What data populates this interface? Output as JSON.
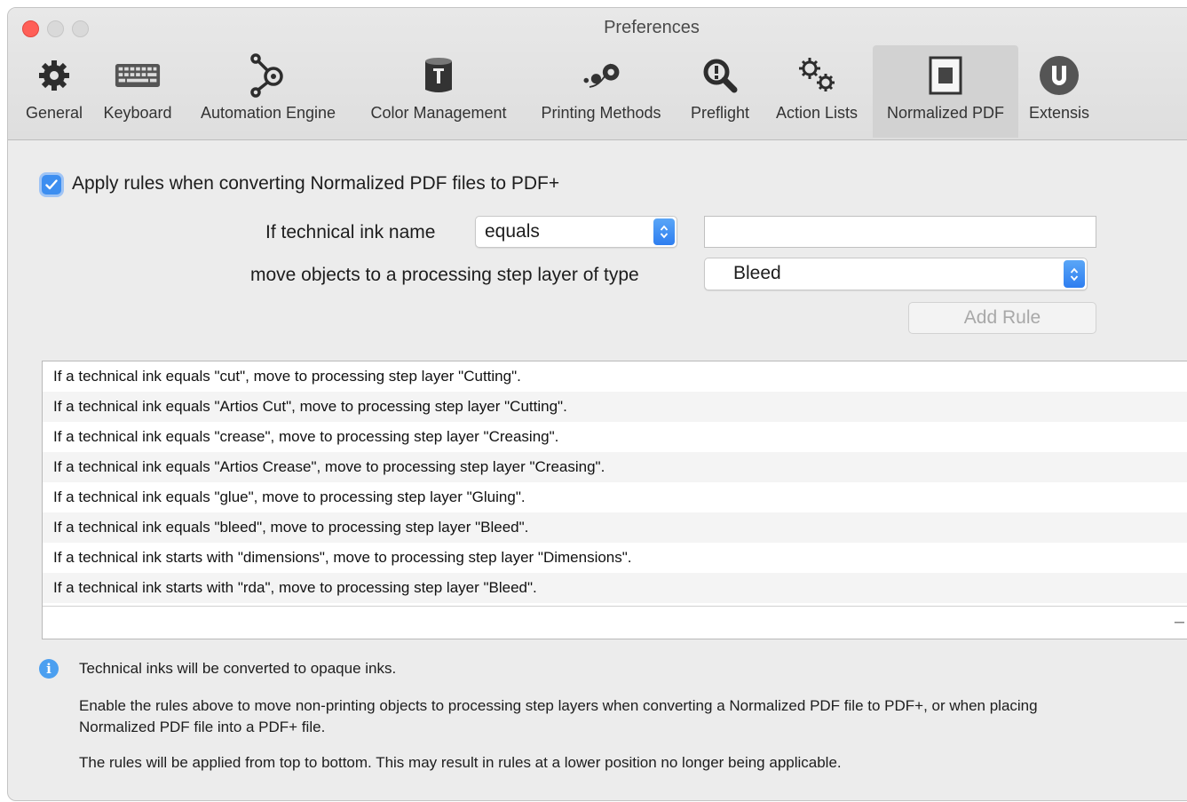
{
  "window": {
    "title": "Preferences"
  },
  "toolbar": {
    "items": [
      {
        "label": "General",
        "icon": "gear-icon"
      },
      {
        "label": "Keyboard",
        "icon": "keyboard-icon"
      },
      {
        "label": "Automation Engine",
        "icon": "automation-node-icon"
      },
      {
        "label": "Color Management",
        "icon": "color-can-icon"
      },
      {
        "label": "Printing Methods",
        "icon": "printing-dots-icon"
      },
      {
        "label": "Preflight",
        "icon": "magnifier-icon"
      },
      {
        "label": "Action Lists",
        "icon": "gears-icon"
      },
      {
        "label": "Normalized PDF",
        "icon": "normalized-pdf-icon"
      },
      {
        "label": "Extensis",
        "icon": "extensis-icon"
      }
    ],
    "selected": "Normalized PDF"
  },
  "apply": {
    "label": "Apply rules when converting Normalized PDF files to PDF+",
    "checked": true
  },
  "form": {
    "ink_label": "If technical ink name",
    "ink_operator": "equals",
    "ink_value": "",
    "move_label": "move objects to a processing step layer of type",
    "layer_type": "Bleed",
    "add_rule_label": "Add Rule"
  },
  "rules": [
    "If a technical ink equals \"cut\", move to processing step layer \"Cutting\".",
    "If a technical ink equals \"Artios Cut\", move to processing step layer \"Cutting\".",
    "If a technical ink equals \"crease\", move to processing step layer \"Creasing\".",
    "If a technical ink equals \"Artios Crease\", move to processing step layer \"Creasing\".",
    "If a technical ink equals \"glue\", move to processing step layer \"Gluing\".",
    "If a technical ink equals \"bleed\", move to processing step layer \"Bleed\".",
    "If a technical ink starts with \"dimensions\", move to processing step layer \"Dimensions\".",
    "If a technical ink starts with \"rda\", move to processing step layer \"Bleed\"."
  ],
  "rules_footer": {
    "remove_label": "–"
  },
  "notes": {
    "line1": "Technical inks will be converted to opaque inks.",
    "line2a": "Enable the rules above to move non-printing objects to processing step layers when converting a Normalized PDF file to PDF+, or when placing",
    "line2b": "Normalized PDF file into a PDF+ file.",
    "line3": "The rules will be applied from top to bottom. This may result in rules at a lower position no longer being applicable."
  },
  "colors": {
    "accent": "#3d8ef0",
    "close": "#ff5f57",
    "info": "#4b9ff0"
  }
}
